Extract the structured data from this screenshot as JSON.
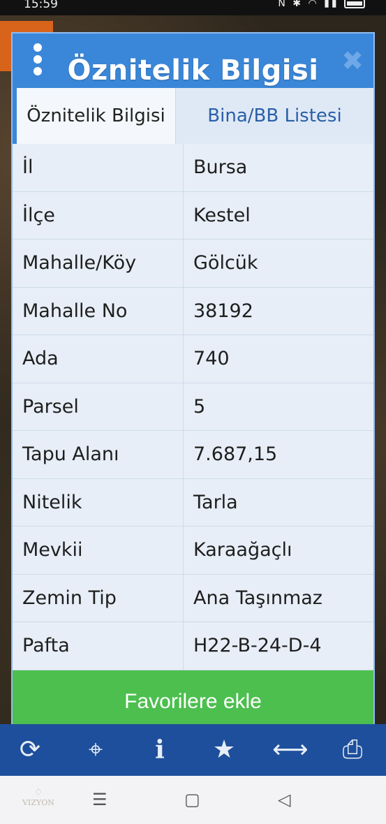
{
  "status_bar": {
    "time": "15:59"
  },
  "dialog": {
    "title": "Öznitelik Bilgisi",
    "tabs": [
      {
        "label": "Öznitelik Bilgisi",
        "active": true
      },
      {
        "label": "Bina/BB Listesi",
        "active": false
      }
    ],
    "rows": [
      {
        "label": "İl",
        "value": "Bursa"
      },
      {
        "label": "İlçe",
        "value": "Kestel"
      },
      {
        "label": "Mahalle/Köy",
        "value": "Gölcük"
      },
      {
        "label": "Mahalle No",
        "value": "38192"
      },
      {
        "label": "Ada",
        "value": "740"
      },
      {
        "label": "Parsel",
        "value": "5"
      },
      {
        "label": "Tapu Alanı",
        "value": "7.687,15"
      },
      {
        "label": "Nitelik",
        "value": "Tarla"
      },
      {
        "label": "Mevkii",
        "value": "Karaağaçlı"
      },
      {
        "label": "Zemin Tip",
        "value": "Ana Taşınmaz"
      },
      {
        "label": "Pafta",
        "value": "H22-B-24-D-4"
      }
    ],
    "favorite_button": "Favorilere ekle"
  },
  "toolbar": {
    "icons": [
      "refresh-icon",
      "crosshair-icon",
      "info-icon",
      "star-icon",
      "resize-arrows-icon",
      "printer-icon"
    ]
  },
  "navbar": {
    "logo_text": "VIZYON"
  },
  "colors": {
    "dialog_blue": "#3a87d9",
    "tab_text_blue": "#2a5fa8",
    "table_bg": "#e7eef7",
    "favorite_green": "#4cbf4f",
    "toolbar_blue": "#1e4f9c"
  }
}
